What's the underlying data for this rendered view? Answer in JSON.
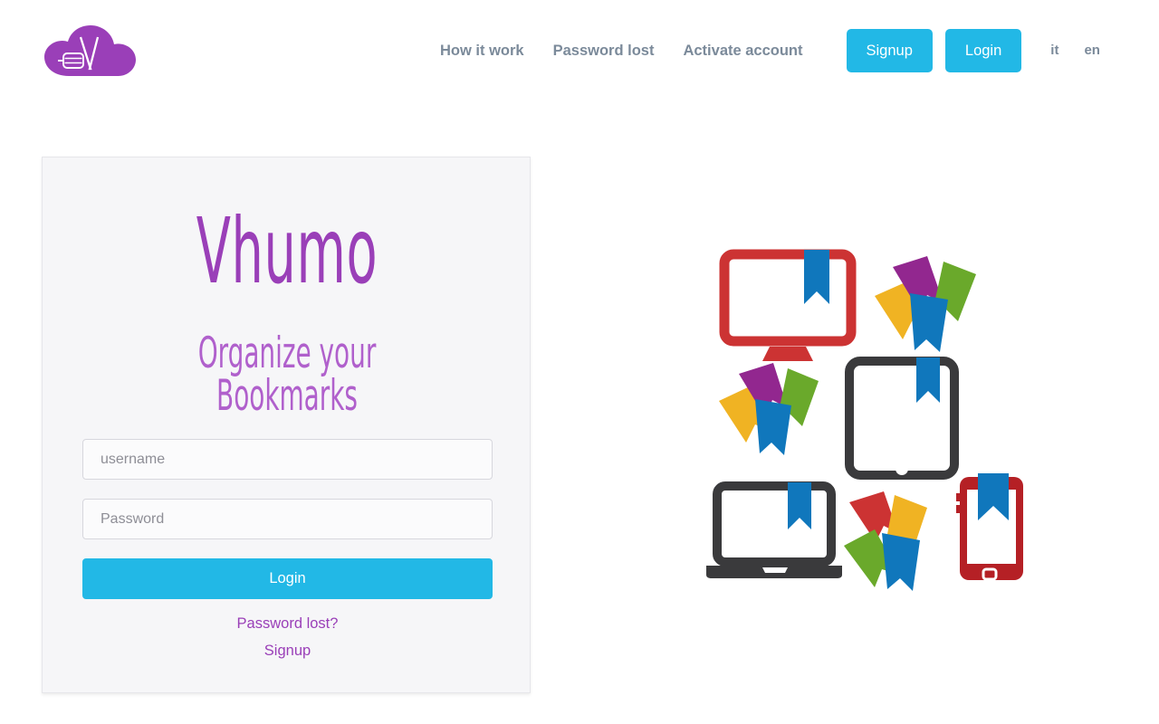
{
  "header": {
    "logo": {
      "icon": "cloud-v-logo-icon",
      "cloud_color": "#9a3fb8",
      "mark_color": "#ffffff"
    },
    "nav_links": [
      {
        "label": "How it work"
      },
      {
        "label": "Password lost"
      },
      {
        "label": "Activate account"
      }
    ],
    "buttons": [
      {
        "label": "Signup"
      },
      {
        "label": "Login"
      }
    ],
    "languages": [
      {
        "label": "it"
      },
      {
        "label": "en"
      }
    ],
    "nav_color": "#7b8a9a",
    "button_color": "#22b8e6"
  },
  "card": {
    "title": "Vhumo",
    "subtitle": "Organize your Bookmarks",
    "title_color": "#9a3fb8",
    "subtitle_color": "#b060cc",
    "background": "#f6f6f8",
    "form": {
      "username": {
        "value": "",
        "placeholder": "username"
      },
      "password": {
        "value": "",
        "placeholder": "Password"
      },
      "submit_label": "Login"
    },
    "links": [
      {
        "label": "Password lost?"
      },
      {
        "label": "Signup"
      }
    ],
    "link_color": "#9a3fb8"
  },
  "illustration": {
    "name": "devices-with-bookmarks-illustration",
    "devices": [
      {
        "name": "desktop-monitor",
        "color": "#cc3333",
        "bookmark_color": "#1077bc"
      },
      {
        "name": "tablet",
        "color": "#3a3a3c",
        "bookmark_color": "#1077bc"
      },
      {
        "name": "laptop",
        "color": "#3a3a3c",
        "bookmark_color": "#1077bc"
      },
      {
        "name": "smartphone",
        "color": "#b52025",
        "bookmark_color": "#1077bc"
      }
    ],
    "bookmark_colors": {
      "blue": "#1077bc",
      "purple": "#92278f",
      "green": "#6aa92b",
      "yellow": "#f0b323",
      "red": "#cc3333"
    }
  }
}
